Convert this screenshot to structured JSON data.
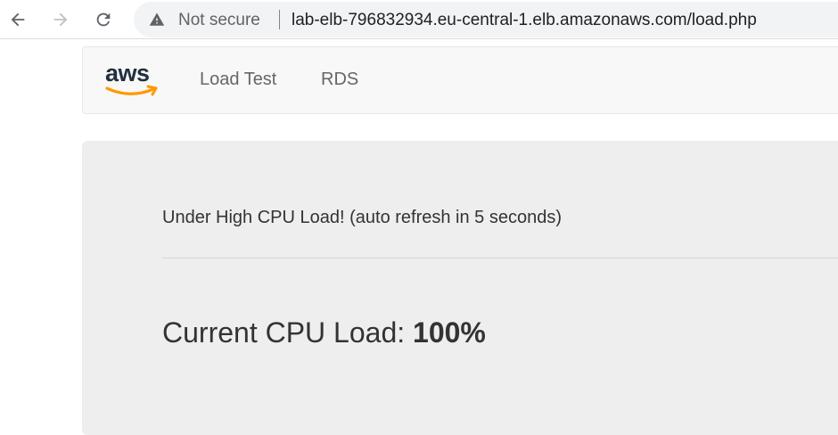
{
  "browser": {
    "security_label": "Not secure",
    "url": "lab-elb-796832934.eu-central-1.elb.amazonaws.com/load.php",
    "icons": {
      "back": "back-arrow-icon",
      "forward": "forward-arrow-icon",
      "reload": "reload-icon",
      "security": "warning-triangle-icon"
    }
  },
  "navbar": {
    "logo_text": "aws",
    "links": [
      {
        "label": "Load Test"
      },
      {
        "label": "RDS"
      }
    ],
    "colors": {
      "logo_text": "#232f3e",
      "logo_smile": "#ff9900"
    }
  },
  "main": {
    "status_text": "Under High CPU Load! (auto refresh in 5 seconds)",
    "cpu_label": "Current CPU Load: ",
    "cpu_value": "100%"
  }
}
